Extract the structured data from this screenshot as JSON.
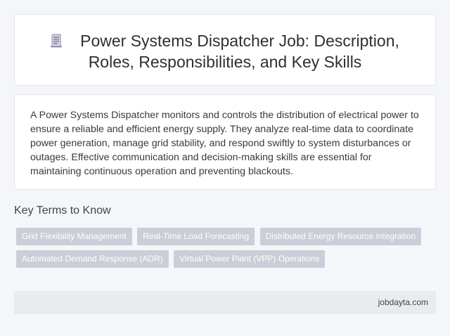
{
  "header": {
    "icon": "document-icon",
    "title_line1": "Power Systems Dispatcher Job: Description,",
    "title_line2": "Roles, Responsibilities, and Key Skills"
  },
  "description": "A Power Systems Dispatcher monitors and controls the distribution of electrical power to ensure a reliable and efficient energy supply. They analyze real-time data to coordinate power generation, manage grid stability, and respond swiftly to system disturbances or outages. Effective communication and decision-making skills are essential for maintaining continuous operation and preventing blackouts.",
  "key_terms": {
    "heading": "Key Terms to Know",
    "tags": [
      "Grid Flexibility Management",
      "Real-Time Load Forecasting",
      "Distributed Energy Resource Integration",
      "Automated Demand Response (ADR)",
      "Virtual Power Plant (VPP) Operations"
    ]
  },
  "footer": {
    "site": "jobdayta.com"
  },
  "colors": {
    "tag_background": "#c9ced8",
    "footer_background": "#e8ecee",
    "page_background": "#f4f6f9"
  }
}
